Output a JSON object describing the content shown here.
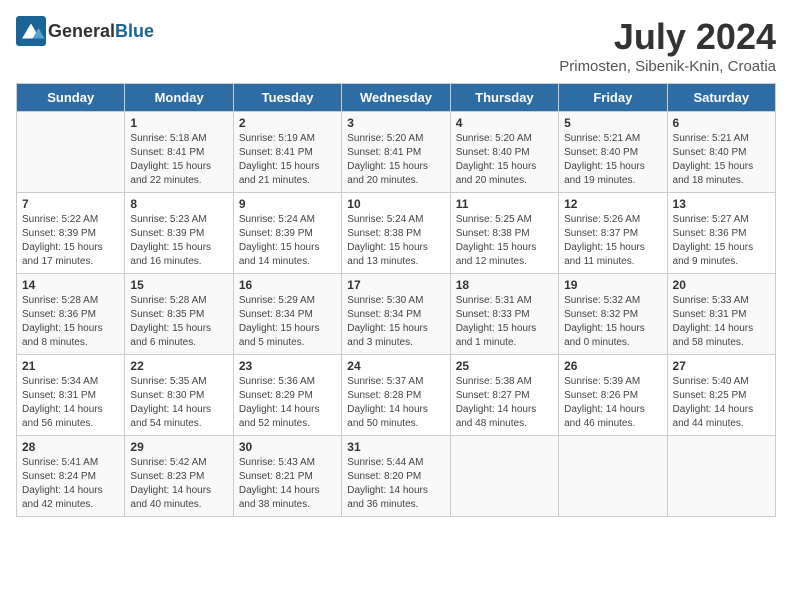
{
  "header": {
    "logo_general": "General",
    "logo_blue": "Blue",
    "month_title": "July 2024",
    "subtitle": "Primosten, Sibenik-Knin, Croatia"
  },
  "days_of_week": [
    "Sunday",
    "Monday",
    "Tuesday",
    "Wednesday",
    "Thursday",
    "Friday",
    "Saturday"
  ],
  "weeks": [
    [
      {
        "day": "",
        "sunrise": "",
        "sunset": "",
        "daylight": ""
      },
      {
        "day": "1",
        "sunrise": "Sunrise: 5:18 AM",
        "sunset": "Sunset: 8:41 PM",
        "daylight": "Daylight: 15 hours and 22 minutes."
      },
      {
        "day": "2",
        "sunrise": "Sunrise: 5:19 AM",
        "sunset": "Sunset: 8:41 PM",
        "daylight": "Daylight: 15 hours and 21 minutes."
      },
      {
        "day": "3",
        "sunrise": "Sunrise: 5:20 AM",
        "sunset": "Sunset: 8:41 PM",
        "daylight": "Daylight: 15 hours and 20 minutes."
      },
      {
        "day": "4",
        "sunrise": "Sunrise: 5:20 AM",
        "sunset": "Sunset: 8:40 PM",
        "daylight": "Daylight: 15 hours and 20 minutes."
      },
      {
        "day": "5",
        "sunrise": "Sunrise: 5:21 AM",
        "sunset": "Sunset: 8:40 PM",
        "daylight": "Daylight: 15 hours and 19 minutes."
      },
      {
        "day": "6",
        "sunrise": "Sunrise: 5:21 AM",
        "sunset": "Sunset: 8:40 PM",
        "daylight": "Daylight: 15 hours and 18 minutes."
      }
    ],
    [
      {
        "day": "7",
        "sunrise": "Sunrise: 5:22 AM",
        "sunset": "Sunset: 8:39 PM",
        "daylight": "Daylight: 15 hours and 17 minutes."
      },
      {
        "day": "8",
        "sunrise": "Sunrise: 5:23 AM",
        "sunset": "Sunset: 8:39 PM",
        "daylight": "Daylight: 15 hours and 16 minutes."
      },
      {
        "day": "9",
        "sunrise": "Sunrise: 5:24 AM",
        "sunset": "Sunset: 8:39 PM",
        "daylight": "Daylight: 15 hours and 14 minutes."
      },
      {
        "day": "10",
        "sunrise": "Sunrise: 5:24 AM",
        "sunset": "Sunset: 8:38 PM",
        "daylight": "Daylight: 15 hours and 13 minutes."
      },
      {
        "day": "11",
        "sunrise": "Sunrise: 5:25 AM",
        "sunset": "Sunset: 8:38 PM",
        "daylight": "Daylight: 15 hours and 12 minutes."
      },
      {
        "day": "12",
        "sunrise": "Sunrise: 5:26 AM",
        "sunset": "Sunset: 8:37 PM",
        "daylight": "Daylight: 15 hours and 11 minutes."
      },
      {
        "day": "13",
        "sunrise": "Sunrise: 5:27 AM",
        "sunset": "Sunset: 8:36 PM",
        "daylight": "Daylight: 15 hours and 9 minutes."
      }
    ],
    [
      {
        "day": "14",
        "sunrise": "Sunrise: 5:28 AM",
        "sunset": "Sunset: 8:36 PM",
        "daylight": "Daylight: 15 hours and 8 minutes."
      },
      {
        "day": "15",
        "sunrise": "Sunrise: 5:28 AM",
        "sunset": "Sunset: 8:35 PM",
        "daylight": "Daylight: 15 hours and 6 minutes."
      },
      {
        "day": "16",
        "sunrise": "Sunrise: 5:29 AM",
        "sunset": "Sunset: 8:34 PM",
        "daylight": "Daylight: 15 hours and 5 minutes."
      },
      {
        "day": "17",
        "sunrise": "Sunrise: 5:30 AM",
        "sunset": "Sunset: 8:34 PM",
        "daylight": "Daylight: 15 hours and 3 minutes."
      },
      {
        "day": "18",
        "sunrise": "Sunrise: 5:31 AM",
        "sunset": "Sunset: 8:33 PM",
        "daylight": "Daylight: 15 hours and 1 minute."
      },
      {
        "day": "19",
        "sunrise": "Sunrise: 5:32 AM",
        "sunset": "Sunset: 8:32 PM",
        "daylight": "Daylight: 15 hours and 0 minutes."
      },
      {
        "day": "20",
        "sunrise": "Sunrise: 5:33 AM",
        "sunset": "Sunset: 8:31 PM",
        "daylight": "Daylight: 14 hours and 58 minutes."
      }
    ],
    [
      {
        "day": "21",
        "sunrise": "Sunrise: 5:34 AM",
        "sunset": "Sunset: 8:31 PM",
        "daylight": "Daylight: 14 hours and 56 minutes."
      },
      {
        "day": "22",
        "sunrise": "Sunrise: 5:35 AM",
        "sunset": "Sunset: 8:30 PM",
        "daylight": "Daylight: 14 hours and 54 minutes."
      },
      {
        "day": "23",
        "sunrise": "Sunrise: 5:36 AM",
        "sunset": "Sunset: 8:29 PM",
        "daylight": "Daylight: 14 hours and 52 minutes."
      },
      {
        "day": "24",
        "sunrise": "Sunrise: 5:37 AM",
        "sunset": "Sunset: 8:28 PM",
        "daylight": "Daylight: 14 hours and 50 minutes."
      },
      {
        "day": "25",
        "sunrise": "Sunrise: 5:38 AM",
        "sunset": "Sunset: 8:27 PM",
        "daylight": "Daylight: 14 hours and 48 minutes."
      },
      {
        "day": "26",
        "sunrise": "Sunrise: 5:39 AM",
        "sunset": "Sunset: 8:26 PM",
        "daylight": "Daylight: 14 hours and 46 minutes."
      },
      {
        "day": "27",
        "sunrise": "Sunrise: 5:40 AM",
        "sunset": "Sunset: 8:25 PM",
        "daylight": "Daylight: 14 hours and 44 minutes."
      }
    ],
    [
      {
        "day": "28",
        "sunrise": "Sunrise: 5:41 AM",
        "sunset": "Sunset: 8:24 PM",
        "daylight": "Daylight: 14 hours and 42 minutes."
      },
      {
        "day": "29",
        "sunrise": "Sunrise: 5:42 AM",
        "sunset": "Sunset: 8:23 PM",
        "daylight": "Daylight: 14 hours and 40 minutes."
      },
      {
        "day": "30",
        "sunrise": "Sunrise: 5:43 AM",
        "sunset": "Sunset: 8:21 PM",
        "daylight": "Daylight: 14 hours and 38 minutes."
      },
      {
        "day": "31",
        "sunrise": "Sunrise: 5:44 AM",
        "sunset": "Sunset: 8:20 PM",
        "daylight": "Daylight: 14 hours and 36 minutes."
      },
      {
        "day": "",
        "sunrise": "",
        "sunset": "",
        "daylight": ""
      },
      {
        "day": "",
        "sunrise": "",
        "sunset": "",
        "daylight": ""
      },
      {
        "day": "",
        "sunrise": "",
        "sunset": "",
        "daylight": ""
      }
    ]
  ]
}
